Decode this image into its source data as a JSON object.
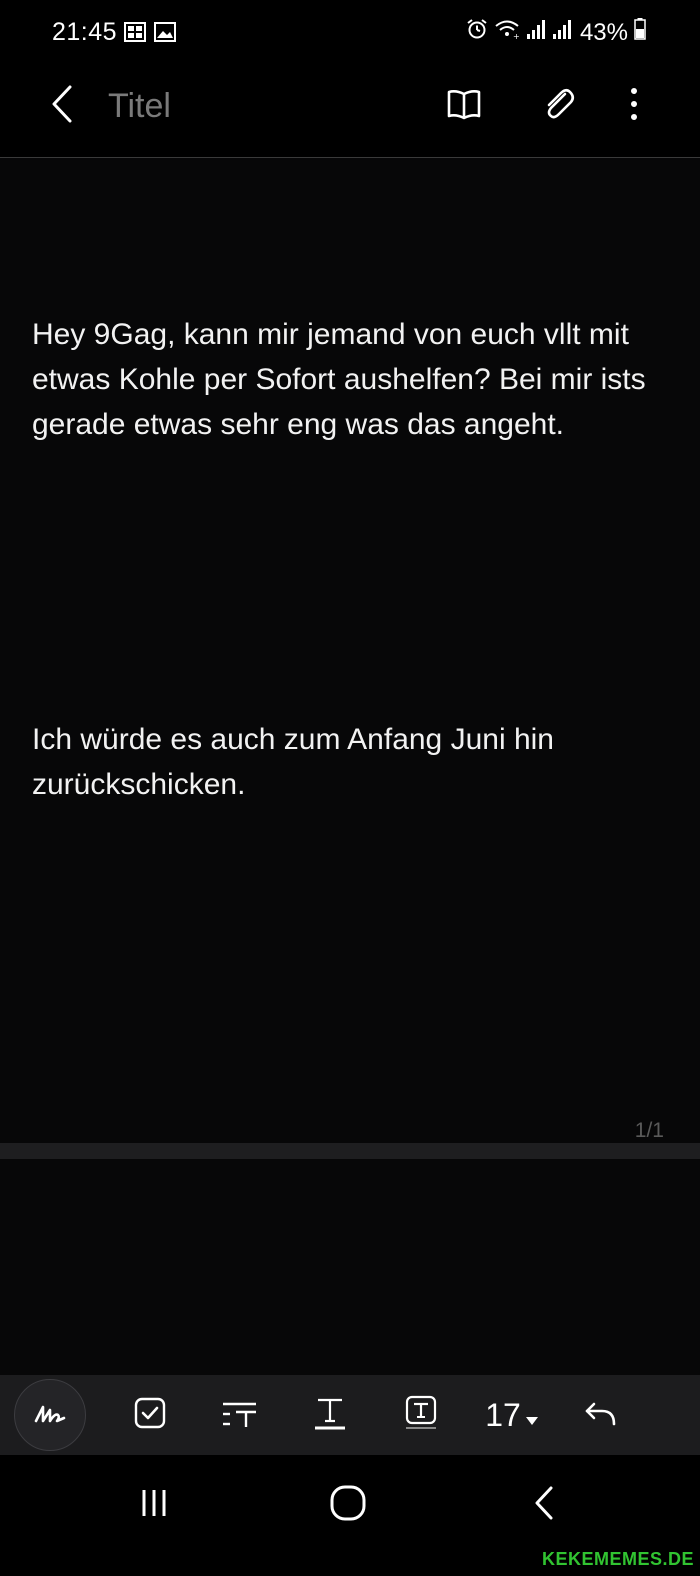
{
  "status_bar": {
    "time": "21:45",
    "battery": "43%",
    "icons": [
      "gallery-notification-icon",
      "image-notification-icon",
      "alarm-icon",
      "wifi-icon",
      "signal-icon",
      "signal-icon",
      "battery-icon"
    ]
  },
  "app_bar": {
    "title_placeholder": "Titel",
    "title_value": "",
    "icons": [
      "back-icon",
      "book-icon",
      "paperclip-icon",
      "more-vertical-icon"
    ]
  },
  "note": {
    "paragraph_1": "Hey 9Gag, kann mir jemand von euch vllt mit etwas Kohle per Sofort aushelfen? Bei mir ists gerade etwas sehr eng was das angeht.",
    "paragraph_2": "Ich würde es auch zum Anfang Juni hin zurückschicken.",
    "page_indicator": "1/1"
  },
  "toolbar": {
    "font_size": "17",
    "tools": [
      "handwriting-icon",
      "checkbox-icon",
      "text-style-icon",
      "font-icon",
      "text-box-icon",
      "caret-down-icon",
      "undo-icon"
    ]
  },
  "nav_bar": {
    "icons": [
      "recent-apps-icon",
      "home-icon",
      "back-icon"
    ]
  },
  "watermark": "KEKEMEMES.DE",
  "colors": {
    "background": "#000000",
    "canvas": "#070708",
    "toolbar": "#1c1c1e",
    "text": "#f2f2f2",
    "muted": "#777777",
    "watermark": "#31c331"
  }
}
